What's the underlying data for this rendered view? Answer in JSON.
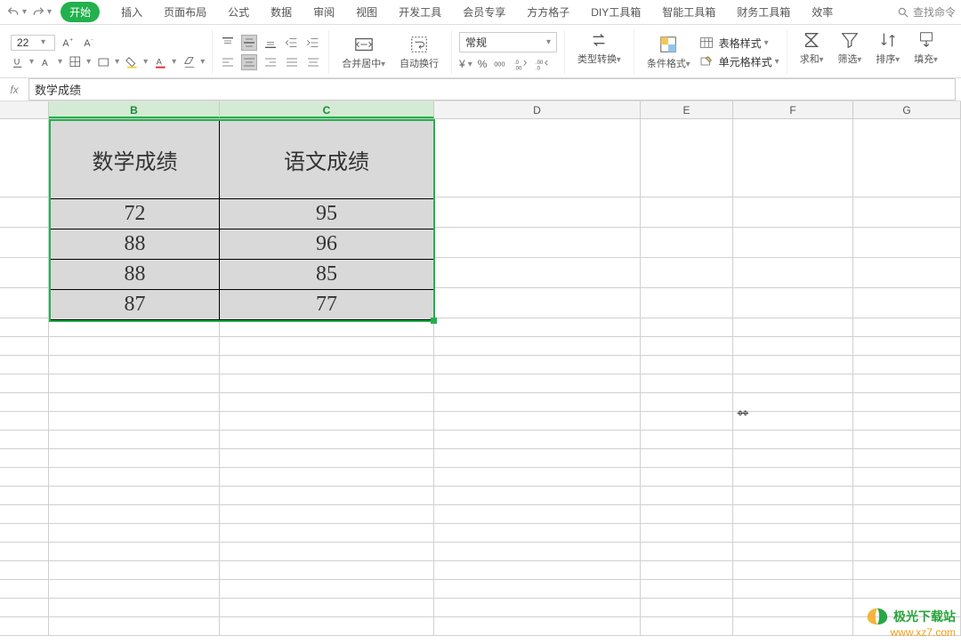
{
  "topbar": {
    "undo": "↶",
    "redo": "↷",
    "tabs": [
      "开始",
      "插入",
      "页面布局",
      "公式",
      "数据",
      "审阅",
      "视图",
      "开发工具",
      "会员专享",
      "方方格子",
      "DIY工具箱",
      "智能工具箱",
      "财务工具箱",
      "效率"
    ],
    "active_tab": "开始",
    "search_placeholder": "查找命令"
  },
  "ribbon": {
    "font_size": "22",
    "merge_label": "合并居中",
    "wrap_label": "自动换行",
    "number_format": "常规",
    "type_convert": "类型转换",
    "cond_format": "条件格式",
    "table_style": "表格样式",
    "cell_style": "单元格样式",
    "sum": "求和",
    "filter": "筛选",
    "sort": "排序",
    "fill": "填充"
  },
  "formula": {
    "value": "数学成绩"
  },
  "columns": {
    "B": "B",
    "C": "C",
    "D": "D",
    "E": "E",
    "F": "F",
    "G": "G"
  },
  "table": {
    "headers": {
      "B": "数学成绩",
      "C": "语文成绩"
    },
    "rows": [
      {
        "B": "72",
        "C": "95"
      },
      {
        "B": "88",
        "C": "96"
      },
      {
        "B": "88",
        "C": "85"
      },
      {
        "B": "87",
        "C": "77"
      }
    ]
  },
  "watermark": {
    "line1": "极光下载站",
    "line2": "www.xz7.com"
  }
}
